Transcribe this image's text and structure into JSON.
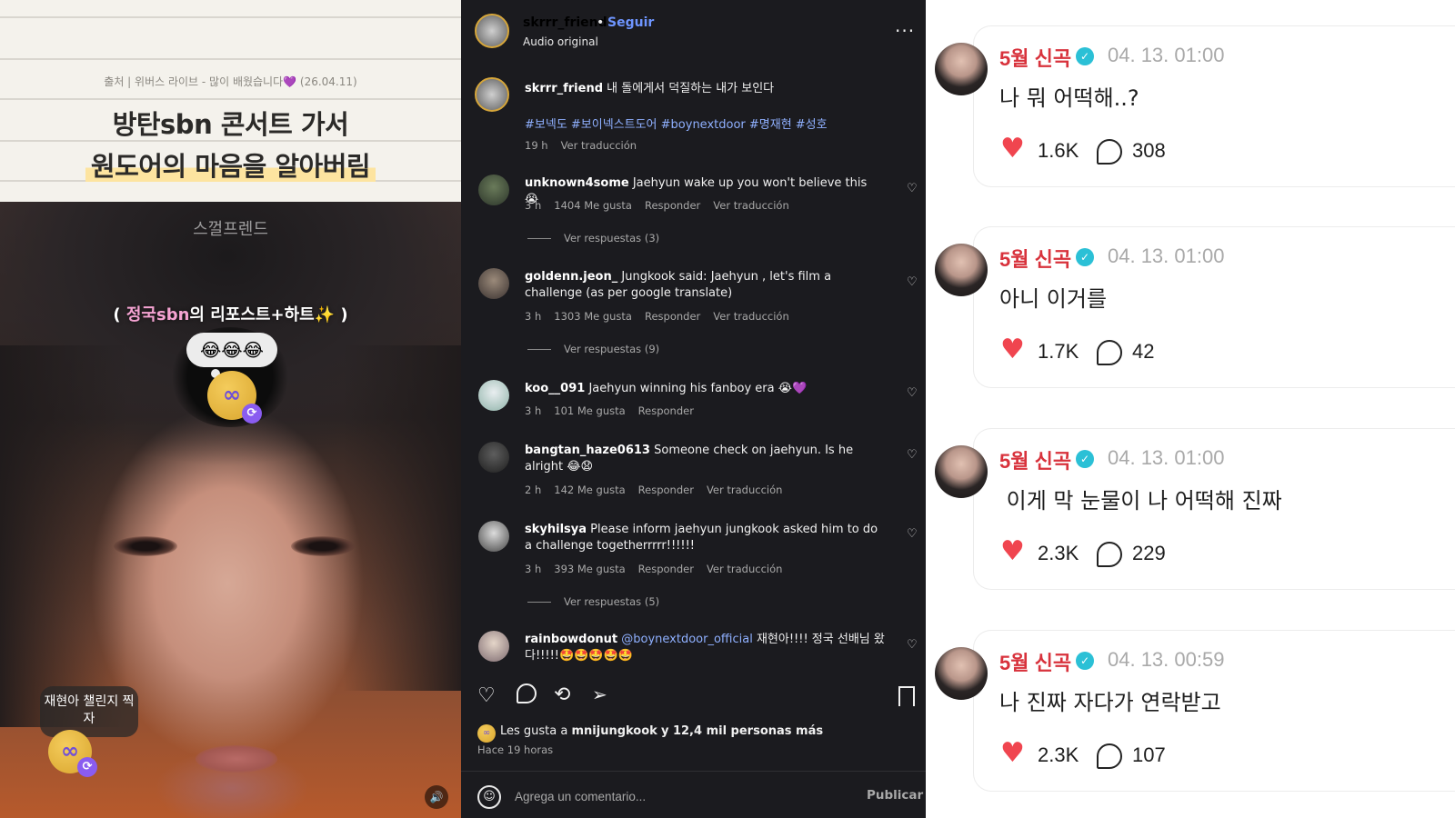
{
  "video": {
    "source_caption": "출처 | 위버스 라이브 - 많이 배웠습니다💜 (26.04.11)",
    "headline_line1": "방탄sbn 콘서트 가서",
    "headline_line2": "원도어의 마음을 알아버림",
    "watermark": "스껄프렌드",
    "paren_open": "( ",
    "paren_pink": "정국sbn",
    "paren_rest": "의 리포스트+하트✨ )",
    "emoji_bubble": "😂😂😂",
    "coin_glyph": "∞",
    "challenge_tag": "재현아 챌린지 찍자"
  },
  "instagram": {
    "header": {
      "username": "skrrr_friend",
      "dot": "•",
      "follow": "Seguir",
      "audio": "Audio original",
      "more": "···"
    },
    "post": {
      "username": "skrrr_friend",
      "text": "내 돌에게서 덕질하는 내가 보인다",
      "hashtags": "#보넥도 #보이넥스트도어 #boynextdoor #명재현 #성호",
      "time": "19 h",
      "translate": "Ver traducción"
    },
    "comments": [
      {
        "username": "unknown4some",
        "text": "Jaehyun wake up you won't believe this😭",
        "time": "3 h",
        "likes": "1404 Me gusta",
        "reply": "Responder",
        "translate": "Ver traducción",
        "replies": "Ver respuestas (3)"
      },
      {
        "username": "goldenn.jeon_",
        "text": "Jungkook said: Jaehyun , let's film a challenge (as per google translate)",
        "time": "3 h",
        "likes": "1303 Me gusta",
        "reply": "Responder",
        "translate": "Ver traducción",
        "replies": "Ver respuestas (9)"
      },
      {
        "username": "koo__091",
        "text": "Jaehyun winning his fanboy era 😭💜",
        "time": "3 h",
        "likes": "101 Me gusta",
        "reply": "Responder"
      },
      {
        "username": "bangtan_haze0613",
        "text": "Someone check on jaehyun. Is he alright 😂😧",
        "time": "2 h",
        "likes": "142 Me gusta",
        "reply": "Responder",
        "translate": "Ver traducción"
      },
      {
        "username": "skyhilsya",
        "text": "Please inform jaehyun jungkook asked him to do a challenge togetherrrrr!!!!!!",
        "time": "3 h",
        "likes": "393 Me gusta",
        "reply": "Responder",
        "translate": "Ver traducción",
        "replies": "Ver respuestas (5)"
      },
      {
        "username": "rainbowdonut",
        "mention": "@boynextdoor_official",
        "text": "재현아!!!! 정국 선배님 왔다!!!!!🤩🤩🤩🤩🤩"
      }
    ],
    "likes_prefix": "Les gusta a",
    "likes_user": "mnijungkook",
    "likes_suffix": "y 12,4 mil personas más",
    "posted_ago": "Hace 19 horas",
    "comment_placeholder": "Agrega un comentario...",
    "publish": "Publicar",
    "icons": [
      "heart-icon",
      "comment-icon",
      "repost-icon",
      "share-icon",
      "bookmark-icon"
    ]
  },
  "weverse": {
    "posts": [
      {
        "name": "5월 신곡",
        "date": "04. 13. 01:00",
        "body": "나 뭐 어떡해..?",
        "likes": "1.6K",
        "comments": "308"
      },
      {
        "name": "5월 신곡",
        "date": "04. 13. 01:00",
        "body": "아니 이거를",
        "likes": "1.7K",
        "comments": "42"
      },
      {
        "name": "5월 신곡",
        "date": "04. 13. 01:00",
        "body": " 이게 막 눈물이 나 어떡해 진짜",
        "likes": "2.3K",
        "comments": "229"
      },
      {
        "name": "5월 신곡",
        "date": "04. 13. 00:59",
        "body": "나 진짜 자다가 연락받고",
        "likes": "2.3K",
        "comments": "107"
      }
    ],
    "name_color": "#d8323c",
    "heart_color": "#f0454f",
    "badge_color": "#2bc0d6"
  }
}
